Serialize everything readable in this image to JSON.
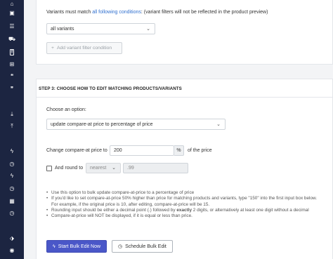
{
  "sidebar": {
    "icons": [
      "home-icon",
      "briefcase-icon",
      "list-icon",
      "cart-icon",
      "facebook-icon",
      "windows-icon",
      "quote-icon",
      "quote-icon",
      "download-icon",
      "upload-icon",
      "bolt-icon",
      "clock-icon",
      "bolt-icon",
      "clock-icon",
      "table-icon",
      "clock-icon",
      "tags-icon",
      "circle-icon"
    ]
  },
  "variants": {
    "text_before": "Variants must match ",
    "link": "all following conditions",
    "text_after": ": (variant filters will not be reflected in the product preview)",
    "select_value": "all variants",
    "add_button": "Add variant filter condition"
  },
  "step3": {
    "title": "STEP 3: CHOOSE HOW TO EDIT MATCHING PRODUCTS/VARIANTS",
    "choose_label": "Choose an option:",
    "option_value": "update compare-at price to percentage of price",
    "change_label": "Change compare-at price to",
    "percent_value": "200",
    "percent_addon": "%",
    "of_price": "of the price",
    "round_label": "And round to",
    "round_mode": "nearest",
    "round_value": ".99"
  },
  "help": [
    "Use this option to bulk update compare-at-price to a percentage of price",
    "If you'd like to set compare-at-price 50% higher than price for matching products and variants, type \"150\" into the first input box below.",
    "For example, if the original price is 10, after editing, compare-at-price will be 15.",
    "exactly",
    "Rounding input should be either a decimal point (.) followed by ",
    " 2 digits, or alternatively at least one digit without a decimal",
    "Compare-at-price will NOT be displayed, if it is equal or less than price."
  ],
  "buttons": {
    "start": "Start Bulk Edit Now",
    "schedule": "Schedule Bulk Edit"
  },
  "colors": {
    "sidebar": "#1c2541",
    "primary": "#4a57c8",
    "link": "#2f6fcf"
  }
}
